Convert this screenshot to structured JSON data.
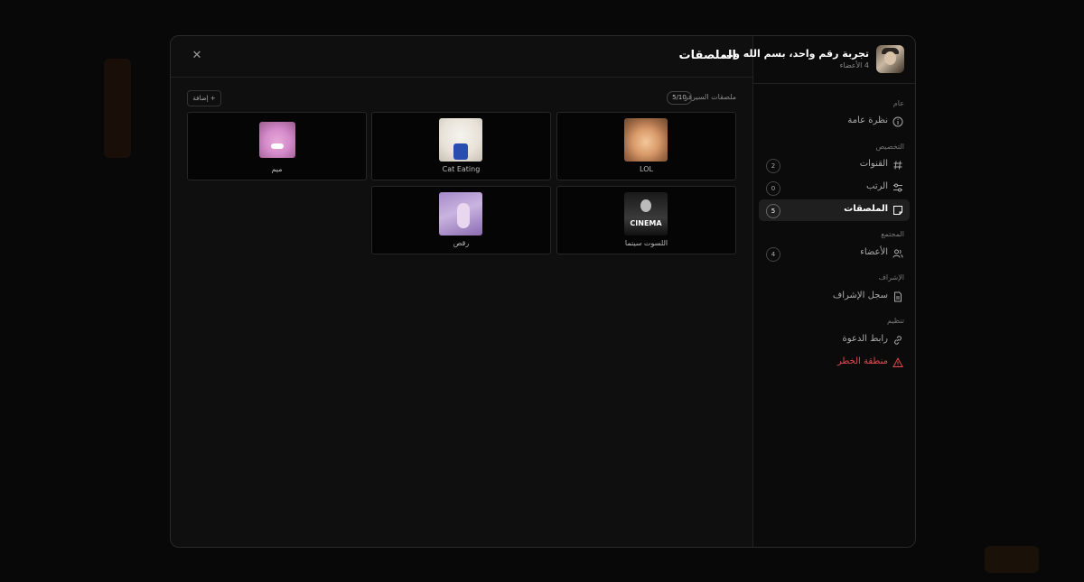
{
  "server": {
    "name": "تجربة رقم واحد، بسم الله و...",
    "members": "4 الأعضاء"
  },
  "sidebar": {
    "sections": [
      {
        "label": "عام"
      },
      {
        "label": "التخصيص"
      },
      {
        "label": "المجتمع"
      },
      {
        "label": "الإشراف"
      },
      {
        "label": "تنظيم"
      }
    ],
    "items": [
      {
        "label": "نظرة عامة",
        "icon": "info-icon",
        "count": ""
      },
      {
        "label": "القنوات",
        "icon": "hash-icon",
        "count": "2"
      },
      {
        "label": "الرتب",
        "icon": "sliders-icon",
        "count": "0"
      },
      {
        "label": "الملصقات",
        "icon": "sticker-icon",
        "count": "5"
      },
      {
        "label": "الأعضاء",
        "icon": "users-icon",
        "count": "4"
      },
      {
        "label": "سجل الإشراف",
        "icon": "file-icon",
        "count": ""
      },
      {
        "label": "رابط الدعوة",
        "icon": "link-icon",
        "count": ""
      },
      {
        "label": "منطقة الخطر",
        "icon": "warning-icon",
        "count": ""
      }
    ]
  },
  "main": {
    "title": "الملصقات",
    "count_label": "ملصقات السيرفر",
    "count_badge": "5/10",
    "add_button": "+ إضافة",
    "close_icon": "close-icon"
  },
  "stickers": [
    {
      "label": "LOL"
    },
    {
      "label": "Cat Eating"
    },
    {
      "label": "ميم"
    },
    {
      "label": "اللسوت سينما",
      "image_text": "CINEMA"
    },
    {
      "label": "رقص"
    }
  ],
  "colors": {
    "danger": "#e5484d",
    "active_bg": "#1f1f1f"
  }
}
